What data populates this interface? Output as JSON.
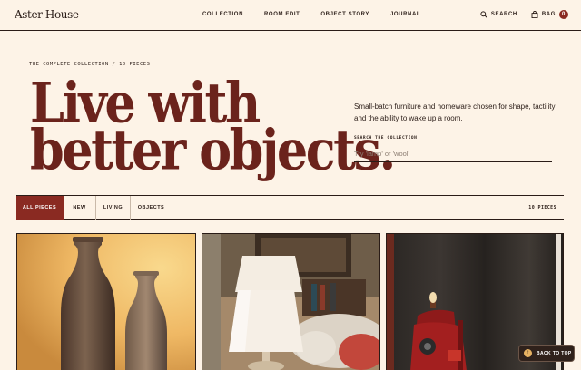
{
  "brand": {
    "name": "Aster House"
  },
  "nav": [
    {
      "label": "COLLECTION"
    },
    {
      "label": "ROOM EDIT"
    },
    {
      "label": "OBJECT STORY"
    },
    {
      "label": "JOURNAL"
    }
  ],
  "actions": {
    "search_label": "SEARCH",
    "bag_label": "BAG",
    "bag_count": "0"
  },
  "hero": {
    "eyebrow": "THE COMPLETE COLLECTION / 10 PIECES",
    "headline_line1": "Live with",
    "headline_line2": "better objects.",
    "intro": "Small-batch furniture and homeware chosen for shape, tactility and the ability to wake up a room.",
    "search_label": "SEARCH THE COLLECTION",
    "search_placeholder": "Try 'lamp' or 'wool'",
    "search_value": ""
  },
  "filters": {
    "tabs": [
      {
        "label": "ALL PIECES",
        "active": true
      },
      {
        "label": "NEW",
        "active": false
      },
      {
        "label": "LIVING",
        "active": false
      },
      {
        "label": "OBJECTS",
        "active": false
      }
    ],
    "count": "10 PIECES"
  },
  "products": [
    {
      "icon": "vase-photo"
    },
    {
      "icon": "lamp-photo"
    },
    {
      "icon": "chair-photo"
    }
  ],
  "back_to_top": {
    "label": "BACK TO TOP",
    "icon": "arrow-up-icon"
  },
  "colors": {
    "background": "#fdf3e7",
    "accent": "#8a2a22",
    "headline": "#6b231c",
    "ink": "#2a1c17"
  }
}
